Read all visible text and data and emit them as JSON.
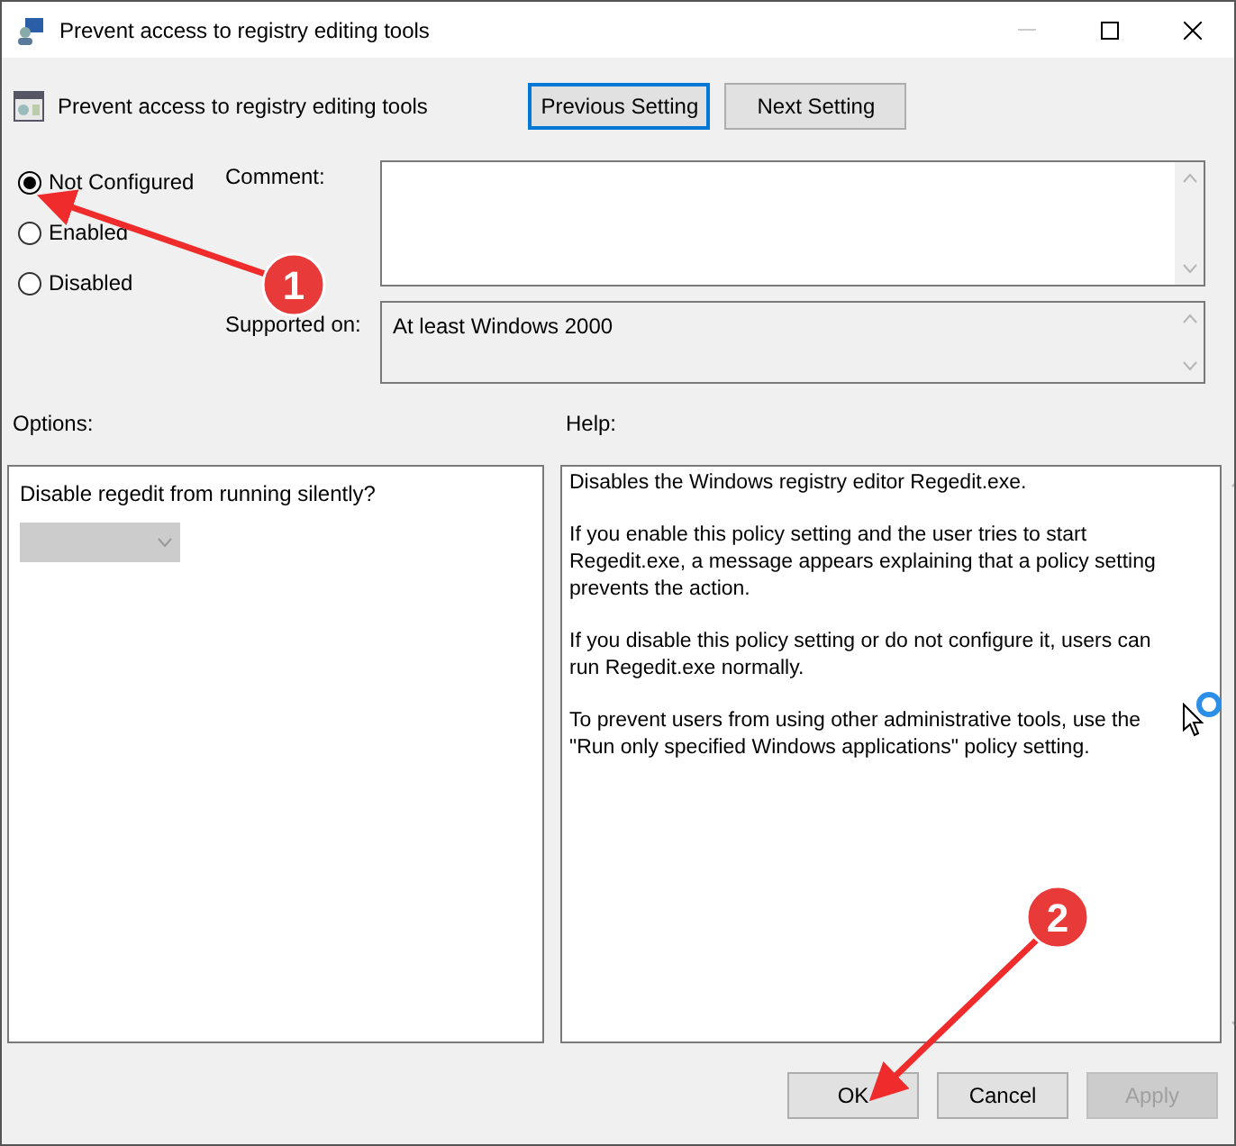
{
  "window": {
    "title": "Prevent access to registry editing tools"
  },
  "header": {
    "policy_name": "Prevent access to registry editing tools",
    "buttons": [
      {
        "label": "Previous Setting",
        "focused": true
      },
      {
        "label": "Next Setting",
        "focused": false
      }
    ]
  },
  "state_options": [
    {
      "label": "Not Configured",
      "selected": true
    },
    {
      "label": "Enabled",
      "selected": false
    },
    {
      "label": "Disabled",
      "selected": false
    }
  ],
  "comment": {
    "label": "Comment:"
  },
  "supported_on": {
    "label": "Supported on:",
    "value": "At least Windows 2000"
  },
  "options": {
    "label": "Options:",
    "question": "Disable regedit from running silently?",
    "dropdown_disabled": true
  },
  "help": {
    "label": "Help:",
    "paragraphs": [
      "Disables the Windows registry editor Regedit.exe.",
      "If you enable this policy setting and the user tries to start Regedit.exe, a message appears explaining that a policy setting prevents the action.",
      "If you disable this policy setting or do not configure it, users can run Regedit.exe normally.",
      "To prevent users from using other administrative tools, use the \"Run only specified Windows applications\" policy setting."
    ]
  },
  "buttons": [
    {
      "label": "OK",
      "disabled": false
    },
    {
      "label": "Cancel",
      "disabled": false
    },
    {
      "label": "Apply",
      "disabled": true
    }
  ],
  "annotations": [
    {
      "number": "1"
    },
    {
      "number": "2"
    }
  ]
}
